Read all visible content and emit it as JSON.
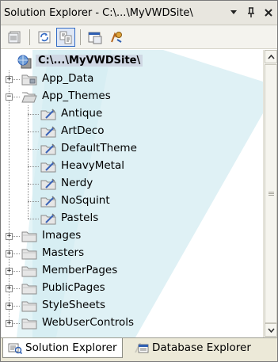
{
  "window": {
    "title": "Solution Explorer - C:\\...\\MyVWDSite\\",
    "buttons": [
      {
        "name": "window-position-button",
        "glyph": "▾",
        "icon": "dropdown-arrow-icon"
      },
      {
        "name": "auto-hide-button",
        "glyph": "ᛘ",
        "icon": "pin-icon"
      },
      {
        "name": "close-button",
        "glyph": "✕",
        "icon": "close-icon"
      }
    ]
  },
  "toolbar": {
    "tools": [
      {
        "name": "properties-button",
        "icon": "properties-icon"
      },
      {
        "name": "refresh-button",
        "icon": "refresh-icon"
      },
      {
        "name": "nest-related-files-button",
        "icon": "nest-related-icon",
        "active": true
      },
      {
        "name": "view-designer-button",
        "icon": "view-designer-icon"
      },
      {
        "name": "copy-website-button",
        "icon": "copy-website-icon"
      }
    ]
  },
  "tree": {
    "root": {
      "label": "C:\\...\\MyVWDSite\\",
      "icon": "website-icon"
    },
    "items": [
      {
        "label": "App_Data",
        "icon": "special-folder-icon",
        "expander": "+",
        "level": 1
      },
      {
        "label": "App_Themes",
        "icon": "open-folder-icon",
        "expander": "−",
        "level": 1
      },
      {
        "label": "Antique",
        "icon": "theme-folder-icon",
        "level": 2
      },
      {
        "label": "ArtDeco",
        "icon": "theme-folder-icon",
        "level": 2
      },
      {
        "label": "DefaultTheme",
        "icon": "theme-folder-icon",
        "level": 2
      },
      {
        "label": "HeavyMetal",
        "icon": "theme-folder-icon",
        "level": 2
      },
      {
        "label": "Nerdy",
        "icon": "theme-folder-icon",
        "level": 2
      },
      {
        "label": "NoSquint",
        "icon": "theme-folder-icon",
        "level": 2
      },
      {
        "label": "Pastels",
        "icon": "theme-folder-icon",
        "level": 2
      },
      {
        "label": "Images",
        "icon": "folder-icon",
        "expander": "+",
        "level": 1
      },
      {
        "label": "Masters",
        "icon": "folder-icon",
        "expander": "+",
        "level": 1
      },
      {
        "label": "MemberPages",
        "icon": "folder-icon",
        "expander": "+",
        "level": 1
      },
      {
        "label": "PublicPages",
        "icon": "folder-icon",
        "expander": "+",
        "level": 1
      },
      {
        "label": "StyleSheets",
        "icon": "folder-icon",
        "expander": "+",
        "level": 1
      },
      {
        "label": "WebUserControls",
        "icon": "folder-icon",
        "expander": "+",
        "level": 1
      }
    ]
  },
  "tabs": [
    {
      "label": "Solution Explorer",
      "icon": "solution-explorer-icon",
      "active": true
    },
    {
      "label": "Database Explorer",
      "icon": "database-explorer-icon",
      "active": false
    }
  ],
  "colors": {
    "selection": "#cfd7e3",
    "watermark": "#d7eef3",
    "titlebar": "#e8e6df",
    "tabbar": "#ece9d8"
  }
}
